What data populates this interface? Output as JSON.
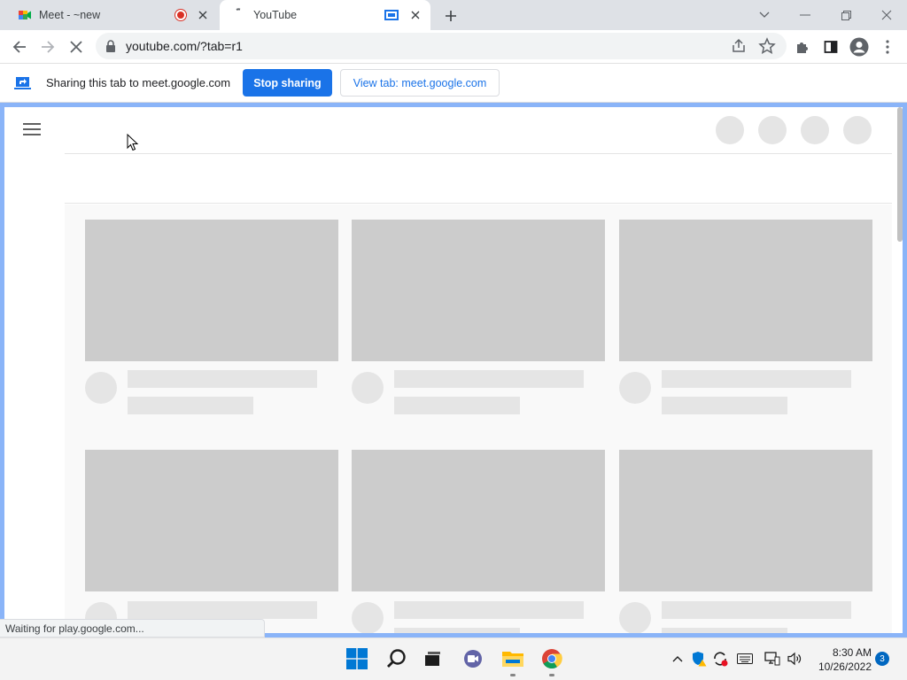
{
  "tabs": [
    {
      "title": "Meet - ~new",
      "state": "inactive",
      "recording": true
    },
    {
      "title": "YouTube",
      "state": "active",
      "sharing": true
    }
  ],
  "toolbar": {
    "url": "youtube.com/?tab=r1"
  },
  "share_bar": {
    "message": "Sharing this tab to meet.google.com",
    "stop_label": "Stop sharing",
    "view_label": "View tab: meet.google.com"
  },
  "status_bar": {
    "text": "Waiting for play.google.com..."
  },
  "taskbar": {
    "time": "8:30 AM",
    "date": "10/26/2022",
    "notification_count": "3"
  },
  "colors": {
    "accent": "#1a73e8",
    "share_frame": "#8ab4f8",
    "skeleton_thumb": "#cccccc",
    "skeleton_text": "#e5e5e5"
  }
}
